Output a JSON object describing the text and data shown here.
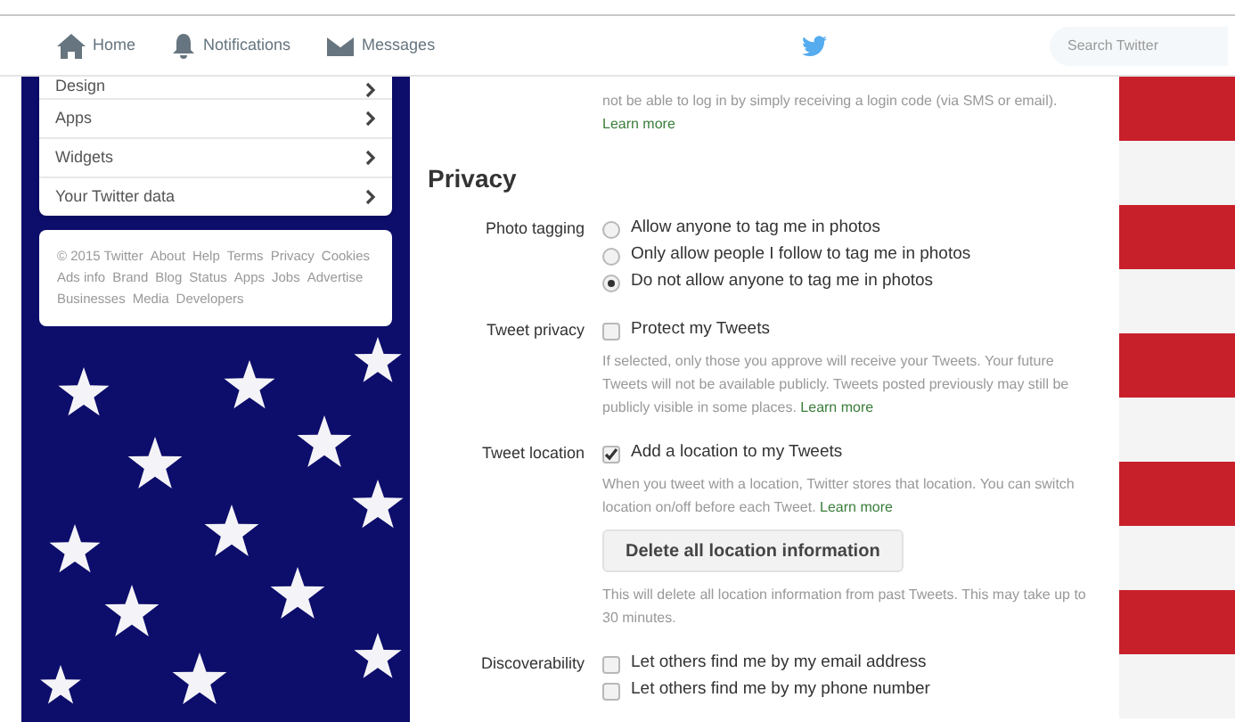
{
  "nav": {
    "items": [
      {
        "label": "Home",
        "kind": "home"
      },
      {
        "label": "Notifications",
        "kind": "bell"
      },
      {
        "label": "Messages",
        "kind": "mail"
      }
    ],
    "search": {
      "placeholder": "Search Twitter"
    }
  },
  "sidebar": {
    "items": [
      "Design",
      "Apps",
      "Widgets",
      "Your Twitter data"
    ]
  },
  "footer": {
    "links": [
      "© 2015 Twitter",
      "About",
      "Help",
      "Terms",
      "Privacy",
      "Cookies",
      "Ads info",
      "Brand",
      "Blog",
      "Status",
      "Apps",
      "Jobs",
      "Advertise",
      "Businesses",
      "Media",
      "Developers"
    ]
  },
  "intro": {
    "text": "not be able to log in by simply receiving a login code (via SMS or email).",
    "link": "Learn more"
  },
  "section": {
    "title": "Privacy",
    "settings": [
      {
        "label": "Photo tagging",
        "kind": "radio",
        "options": [
          {
            "label": "Allow anyone to tag me in photos",
            "selected": false
          },
          {
            "label": "Only allow people I follow to tag me in photos",
            "selected": false
          },
          {
            "label": "Do not allow anyone to tag me in photos",
            "selected": true
          }
        ]
      },
      {
        "label": "Tweet privacy",
        "kind": "checkbox",
        "options": [
          {
            "label": "Protect my Tweets",
            "checked": false
          }
        ],
        "help": "If selected, only those you approve will receive your Tweets. Your future Tweets will not be available publicly. Tweets posted previously may still be publicly visible in some places.",
        "link": "Learn more"
      },
      {
        "label": "Tweet location",
        "kind": "checkbox",
        "options": [
          {
            "label": "Add a location to my Tweets",
            "checked": true
          }
        ],
        "help": "When you tweet with a location, Twitter stores that location. You can switch location on/off before each Tweet.",
        "link": "Learn more",
        "button": "Delete all location information",
        "note": "This will delete all location information from past Tweets. This may take up to 30 minutes."
      },
      {
        "label": "Discoverability",
        "kind": "checkbox",
        "options": [
          {
            "label": "Let others find me by my email address",
            "checked": false
          },
          {
            "label": "Let others find me by my phone number",
            "checked": false
          }
        ]
      }
    ]
  }
}
